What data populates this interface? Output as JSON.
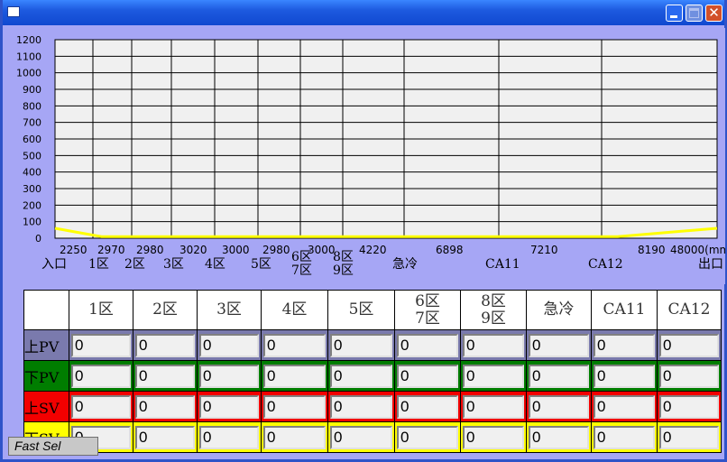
{
  "window": {
    "title": ""
  },
  "chart_data": {
    "type": "line",
    "ylim": [
      0,
      1200
    ],
    "yticks": [
      0,
      100,
      200,
      300,
      400,
      500,
      600,
      700,
      800,
      900,
      1000,
      1100,
      1200
    ],
    "x_position_labels": [
      "2250",
      "2970",
      "2980",
      "3020",
      "3000",
      "2980",
      "3000",
      "4220",
      "6898",
      "7210",
      "8190",
      "48000(mm)"
    ],
    "zone_labels": [
      "入口",
      "1区",
      "2区",
      "3区",
      "4区",
      "5区",
      "6区\n7区",
      "8区\n9区",
      "急冷",
      "CA11",
      "CA12",
      "出口"
    ],
    "grid": true,
    "series": [
      {
        "color": "#ffff00",
        "x": [
          0,
          0.07,
          0.4,
          0.85,
          1.0
        ],
        "y": [
          60,
          10,
          10,
          10,
          60
        ]
      }
    ]
  },
  "table": {
    "headers": [
      "",
      "1区",
      "2区",
      "3区",
      "4区",
      "5区",
      "6区\n7区",
      "8区\n9区",
      "急冷",
      "CA11",
      "CA12"
    ],
    "rows": [
      {
        "label": "上PV",
        "values": [
          "0",
          "0",
          "0",
          "0",
          "0",
          "0",
          "0",
          "0",
          "0",
          "0"
        ]
      },
      {
        "label": "下PV",
        "values": [
          "0",
          "0",
          "0",
          "0",
          "0",
          "0",
          "0",
          "0",
          "0",
          "0"
        ]
      },
      {
        "label": "上SV",
        "values": [
          "0",
          "0",
          "0",
          "0",
          "0",
          "0",
          "0",
          "0",
          "0",
          "0"
        ]
      },
      {
        "label": "下SV",
        "values": [
          "0",
          "0",
          "0",
          "0",
          "0",
          "0",
          "0",
          "0",
          "0",
          "0"
        ]
      }
    ]
  },
  "fast_sel": {
    "label": "Fast Sel"
  },
  "colors": {
    "grid_bg": "#f0f0f0",
    "frame_bg": "#a6a6f5",
    "upv": "#7a7aad",
    "lpv": "#007d00",
    "usv": "#f20000",
    "lsv": "#ffff00",
    "titlebar": "#1d5adf"
  }
}
